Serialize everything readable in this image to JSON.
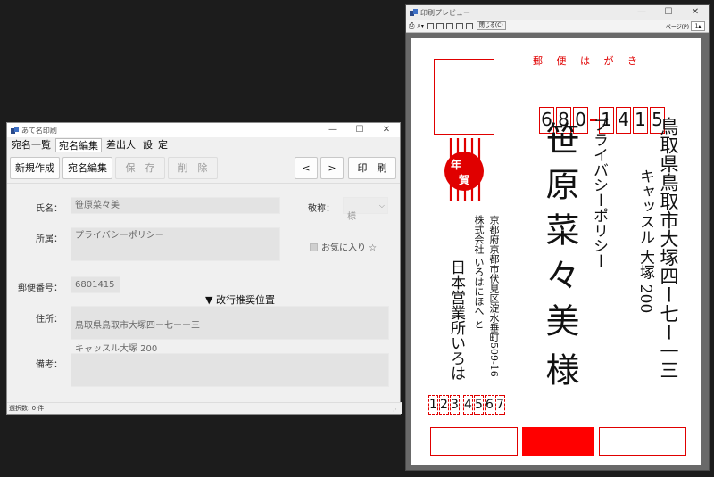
{
  "main_window": {
    "title": "あて名印刷",
    "controls": [
      "—",
      "☐",
      "✕"
    ],
    "menu": [
      "宛名一覧",
      "宛名編集",
      "差出人",
      "設",
      "定"
    ],
    "toolbar": {
      "new": "新規作成",
      "edit": "宛名編集",
      "save": "保　存",
      "delete": "削　除",
      "prev": "<",
      "next": ">",
      "print": "印　刷"
    },
    "form": {
      "name_label": "氏名：",
      "name_value": "笹原菜々美",
      "honorific_label": "敬称：",
      "honorific_value": "様",
      "affiliation_label": "所属：",
      "affiliation_value": "プライバシーポリシー",
      "favorite_label": "お気に入り ☆",
      "postal_label": "郵便番号：",
      "postal_value": "6801415",
      "linebreak_label": "▼ 改行推奨位置",
      "address_label": "住所：",
      "address_line1": "鳥取県鳥取市大塚四ー七ーー三",
      "address_line2": "キャッスル大塚 200",
      "note_label": "備考：",
      "note_value": ""
    },
    "status": "選択数: 0 件"
  },
  "preview_window": {
    "title": "印刷プレビュー",
    "controls": [
      "—",
      "☐",
      "✕"
    ],
    "close_button": "閉じる(C)",
    "page_label": "ページ(P)",
    "page_value": "1",
    "card": {
      "header": "郵 便 は が き",
      "postal_digits": [
        "6",
        "8",
        "0",
        "1",
        "4",
        "1",
        "5"
      ],
      "nenga_chars": [
        "年",
        "賀"
      ],
      "addr1": "鳥取県鳥取市大塚四ー七ー一三",
      "addr2": "キャッスル 大塚 200",
      "company": "プライバシーポリシー",
      "recipient": "笹原菜々美",
      "honorific": "様",
      "sender_addr": "京都府京都市伏見区淀水垂町509-16",
      "sender_company": "株式会社 いろはにほへ と",
      "sender_name": "日本営業所いろは",
      "sender_postal": [
        "1",
        "2",
        "3",
        "4",
        "5",
        "6",
        "7"
      ]
    }
  },
  "colors": {
    "accent_red": "#e00000",
    "desktop": "#1c1c1c",
    "preview_bg": "#696969"
  }
}
